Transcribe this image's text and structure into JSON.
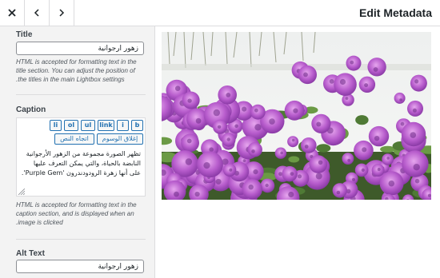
{
  "header": {
    "title": "Edit Metadata",
    "icons": [
      "close-icon",
      "chevron-left-icon",
      "chevron-right-icon"
    ]
  },
  "title_field": {
    "label": "Title",
    "value": "زهور أرجوانية",
    "help": "HTML is accepted for formatting text in the title section. You can adjust the position of the titles in the main Lightbox settings."
  },
  "caption": {
    "label": "Caption",
    "buttons": [
      "b",
      "i",
      "link",
      "ul",
      "ol",
      "li",
      "إغلاق الوسوم",
      "اتجاه النص"
    ],
    "value": "تظهر الصورة مجموعة من الزهور الأرجوانية النابضة بالحياة، والتي يمكن التعرف عليها على أنها زهرة الرودودندرون 'Purple Gem'.",
    "help": "HTML is accepted for formatting text in the caption section, and is displayed when an image is clicked."
  },
  "alt_text": {
    "label": "Alt Text",
    "value": "زهور أرجوانية"
  },
  "colors": {
    "accent": "#2271b1",
    "sidebar_bg": "#f3f3f3",
    "flower": "#b450c8"
  }
}
